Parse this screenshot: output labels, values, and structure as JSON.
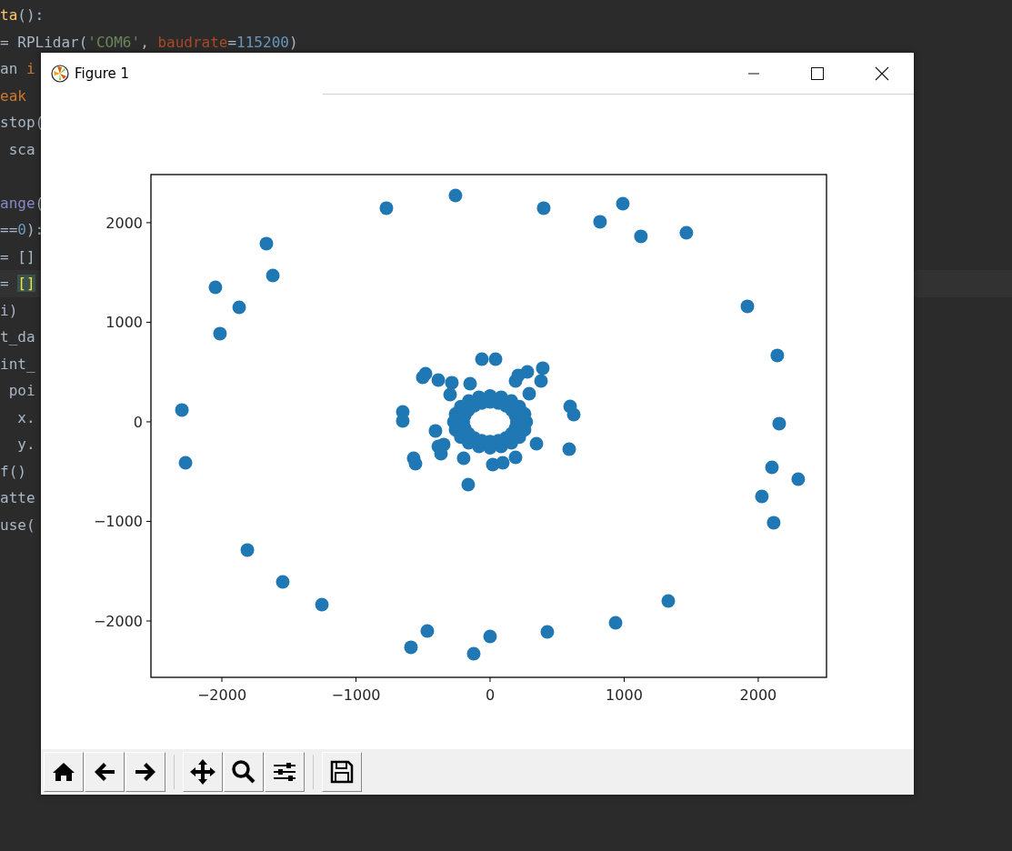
{
  "editor": {
    "lines": [
      {
        "segments": [
          {
            "text": "ta",
            "kind": "func"
          },
          {
            "text": "():",
            "kind": "plain"
          }
        ]
      },
      {
        "segments": [
          {
            "text": "= RPLidar(",
            "kind": "plain"
          },
          {
            "text": "'COM6'",
            "kind": "string"
          },
          {
            "text": ", ",
            "kind": "plain"
          },
          {
            "text": "baudrate",
            "kind": "param"
          },
          {
            "text": "=",
            "kind": "plain"
          },
          {
            "text": "115200",
            "kind": "number"
          },
          {
            "text": ")",
            "kind": "plain"
          }
        ]
      },
      {
        "segments": [
          {
            "text": "an ",
            "kind": "plain"
          },
          {
            "text": "i",
            "kind": "keyword"
          }
        ]
      },
      {
        "segments": [
          {
            "text": "eak",
            "kind": "keyword"
          }
        ]
      },
      {
        "segments": [
          {
            "text": "stop(",
            "kind": "plain"
          }
        ]
      },
      {
        "segments": [
          {
            "text": " sca",
            "kind": "plain"
          }
        ]
      },
      {
        "blank_before": true,
        "segments": [
          {
            "text": "ange",
            "kind": "builtin"
          },
          {
            "text": "(",
            "kind": "plain"
          }
        ]
      },
      {
        "segments": [
          {
            "text": "==",
            "kind": "plain"
          },
          {
            "text": "0",
            "kind": "number"
          },
          {
            "text": "):",
            "kind": "plain"
          }
        ]
      },
      {
        "segments": [
          {
            "text": "= []",
            "kind": "plain"
          }
        ]
      },
      {
        "current": true,
        "segments": [
          {
            "text": "= ",
            "kind": "plain"
          },
          {
            "text": "[]",
            "kind": "bracket"
          }
        ]
      },
      {
        "segments": [
          {
            "text": "i)",
            "kind": "plain"
          }
        ]
      },
      {
        "segments": [
          {
            "text": "t_da",
            "kind": "plain"
          }
        ]
      },
      {
        "segments": [
          {
            "text": "int_",
            "kind": "plain"
          }
        ]
      },
      {
        "segments": [
          {
            "text": " poi",
            "kind": "plain"
          }
        ]
      },
      {
        "segments": [
          {
            "text": "  x.",
            "kind": "plain"
          }
        ]
      },
      {
        "segments": [
          {
            "text": "  y.",
            "kind": "plain"
          }
        ]
      },
      {
        "segments": [
          {
            "text": "f()",
            "kind": "plain"
          }
        ]
      },
      {
        "segments": [
          {
            "text": "atte",
            "kind": "plain"
          }
        ]
      },
      {
        "segments": [
          {
            "text": "use(",
            "kind": "plain"
          }
        ]
      }
    ]
  },
  "window": {
    "title": "Figure 1"
  },
  "figure": {
    "chart_data": {
      "type": "scatter",
      "x": [
        -773,
        -258,
        400,
        820,
        990,
        1125,
        1464,
        -1668,
        -1620,
        -2048,
        -1871,
        -2014,
        1919,
        2142,
        -2298,
        2156,
        -2271,
        2102,
        2298,
        2027,
        2115,
        -1810,
        -1546,
        -1254,
        1329,
        -468,
        -590,
        0,
        427,
        936,
        -122,
        -61,
        41,
        -481,
        -502,
        -386,
        -285,
        -298,
        -149,
        210,
        278,
        393,
        380,
        190,
        292,
        -651,
        -651,
        597,
        624,
        -407,
        -386,
        -346,
        -366,
        -570,
        -556,
        -197,
        20,
        95,
        190,
        346,
        590,
        -163,
        200,
        190,
        162,
        118,
        62,
        0,
        -62,
        -118,
        -162,
        -190,
        -200,
        -190,
        -162,
        -118,
        -62,
        0,
        62,
        118,
        162,
        190,
        270,
        257,
        218,
        159,
        83,
        0,
        -83,
        -159,
        -218,
        -257,
        -270,
        -257,
        -218,
        -159,
        -83,
        0,
        83,
        159,
        218,
        257
      ],
      "series": [
        {
          "color": "#1f77b4",
          "values": [
            2146,
            2273,
            2146,
            2009,
            2191,
            1863,
            1899,
            1790,
            1470,
            1351,
            1150,
            886,
            1160,
            667,
            119,
            -18,
            -411,
            -457,
            -575,
            -749,
            -1013,
            -1287,
            -1607,
            -1835,
            -1799,
            -2100,
            -2264,
            -2155,
            -2109,
            -2018,
            -2328,
            630,
            630,
            484,
            447,
            420,
            393,
            274,
            383,
            466,
            502,
            539,
            411,
            411,
            283,
            100,
            9,
            155,
            73,
            -91,
            -247,
            -228,
            -320,
            -365,
            -420,
            -365,
            -429,
            -411,
            -356,
            -219,
            -274,
            -630,
            0,
            62,
            118,
            162,
            190,
            200,
            190,
            162,
            118,
            62,
            0,
            -62,
            -118,
            -162,
            -190,
            -200,
            -190,
            -162,
            -118,
            -62,
            0,
            80,
            153,
            210,
            247,
            260,
            247,
            210,
            153,
            80,
            0,
            -80,
            -153,
            -210,
            -247,
            -260,
            -247,
            -210,
            -153,
            -80
          ]
        }
      ],
      "xlim": [
        -2529,
        2509
      ],
      "ylim": [
        -2566,
        2483
      ],
      "xticks": [
        {
          "value": -2000,
          "label": "−2000"
        },
        {
          "value": -1000,
          "label": "−1000"
        },
        0,
        1000,
        2000
      ],
      "yticks": [
        {
          "value": -2000,
          "label": "−2000"
        },
        {
          "value": -1000,
          "label": "−1000"
        },
        0,
        1000,
        2000
      ]
    }
  }
}
